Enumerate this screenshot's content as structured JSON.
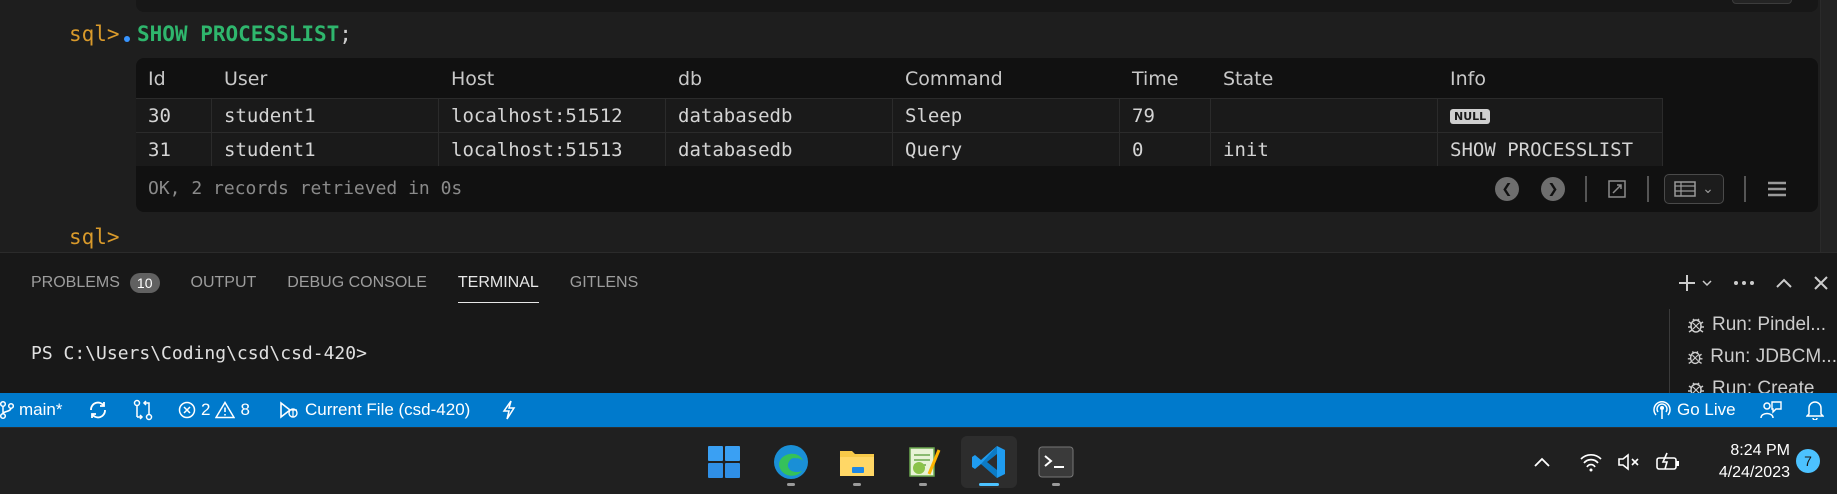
{
  "console": {
    "prompt_label": "sql>",
    "query_text": "SHOW PROCESSLIST",
    "query_terminator": ";",
    "result": {
      "columns": [
        "Id",
        "User",
        "Host",
        "db",
        "Command",
        "Time",
        "State",
        "Info"
      ],
      "rows": [
        [
          "30",
          "student1",
          "localhost:51512",
          "databasedb",
          "Sleep",
          "79",
          "",
          "NULL"
        ],
        [
          "31",
          "student1",
          "localhost:51513",
          "databasedb",
          "Query",
          "0",
          "init",
          "SHOW PROCESSLIST"
        ]
      ],
      "status": "OK, 2 records retrieved in 0s"
    },
    "next_prompt_label": "sql>"
  },
  "panel": {
    "tabs": [
      {
        "label": "PROBLEMS",
        "badge": "10"
      },
      {
        "label": "OUTPUT"
      },
      {
        "label": "DEBUG CONSOLE"
      },
      {
        "label": "TERMINAL",
        "active": true
      },
      {
        "label": "GITLENS"
      }
    ],
    "terminal_prompt": "PS C:\\Users\\Coding\\csd\\csd-420>",
    "run_items": [
      "Run: Pindel...",
      "Run: JDBCM...",
      "Run: Create"
    ]
  },
  "statusbar": {
    "branch": "main*",
    "errors": "2",
    "warnings": "8",
    "run_config": "Current File (csd-420)",
    "go_live": "Go Live",
    "background_color": "#007acc"
  },
  "taskbar": {
    "apps": [
      "start-icon",
      "edge-icon",
      "file-explorer-icon",
      "notepad-plus-plus-icon",
      "vscode-icon",
      "terminal-icon"
    ],
    "time": "8:24 PM",
    "date": "4/24/2023",
    "notification_count": "7"
  }
}
